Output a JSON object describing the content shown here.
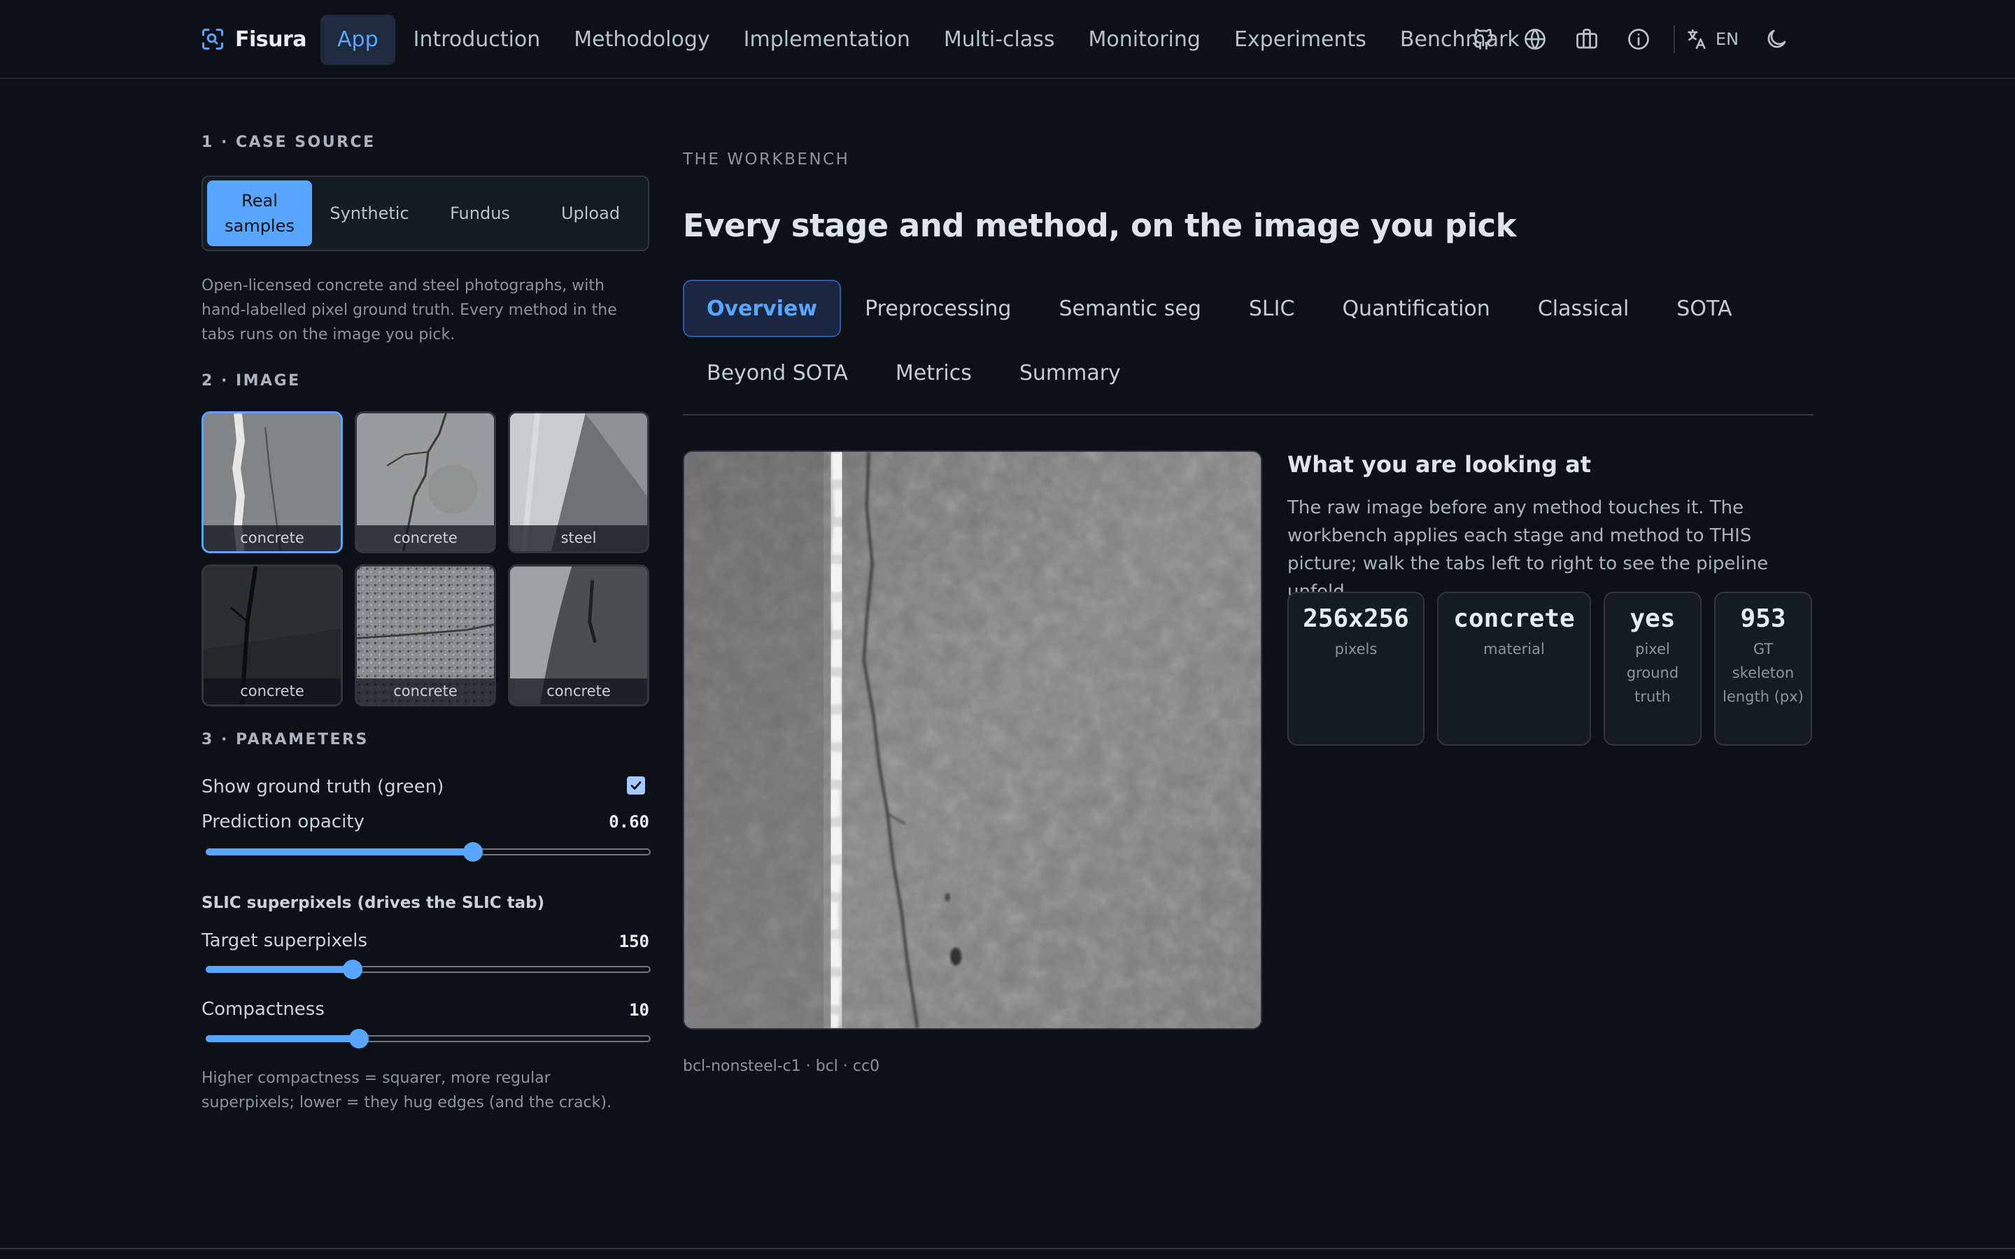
{
  "brand": {
    "name": "Fisura",
    "icon": "scan-icon"
  },
  "nav": {
    "items": [
      {
        "label": "App",
        "active": true
      },
      {
        "label": "Introduction"
      },
      {
        "label": "Methodology"
      },
      {
        "label": "Implementation"
      },
      {
        "label": "Multi-class"
      },
      {
        "label": "Monitoring"
      },
      {
        "label": "Experiments"
      },
      {
        "label": "Benchmark"
      }
    ],
    "icons": [
      "github-icon",
      "globe-icon",
      "briefcase-icon",
      "info-icon"
    ],
    "language": "EN",
    "theme_icon": "moon-icon"
  },
  "sidebar": {
    "case_source": {
      "title": "1 · CASE SOURCE",
      "options": [
        {
          "label": "Real samples",
          "active": true
        },
        {
          "label": "Synthetic"
        },
        {
          "label": "Fundus"
        },
        {
          "label": "Upload"
        }
      ],
      "description": "Open-licensed concrete and steel photographs, with hand-labelled pixel ground truth. Every method in the tabs runs on the image you pick."
    },
    "image": {
      "title": "2 · IMAGE",
      "thumbnails": [
        {
          "label": "concrete",
          "selected": true
        },
        {
          "label": "concrete"
        },
        {
          "label": "steel"
        },
        {
          "label": "concrete"
        },
        {
          "label": "concrete"
        },
        {
          "label": "concrete"
        }
      ]
    },
    "parameters": {
      "title": "3 · PARAMETERS",
      "show_gt_label": "Show ground truth (green)",
      "show_gt_checked": true,
      "opacity_label": "Prediction opacity",
      "opacity_value": "0.60",
      "opacity_fraction": 0.6,
      "slic_title": "SLIC superpixels (drives the SLIC tab)",
      "superpixels_label": "Target superpixels",
      "superpixels_value": "150",
      "superpixels_fraction": 0.33,
      "compactness_label": "Compactness",
      "compactness_value": "10",
      "compactness_fraction": 0.345,
      "hint": "Higher compactness = squarer, more regular superpixels; lower = they hug edges (and the crack)."
    }
  },
  "main": {
    "eyebrow": "THE WORKBENCH",
    "headline": "Every stage and method, on the image you pick",
    "tabs_row1": [
      {
        "label": "Overview",
        "active": true
      },
      {
        "label": "Preprocessing"
      },
      {
        "label": "Semantic seg"
      },
      {
        "label": "SLIC"
      },
      {
        "label": "Quantification"
      },
      {
        "label": "Classical"
      },
      {
        "label": "SOTA"
      }
    ],
    "tabs_row2": [
      {
        "label": "Beyond SOTA"
      },
      {
        "label": "Metrics"
      },
      {
        "label": "Summary"
      }
    ],
    "caption": "bcl-nonsteel-c1 · bcl · cc0",
    "look_title": "What you are looking at",
    "look_text": "The raw image before any method touches it. The workbench applies each stage and method to THIS picture; walk the tabs left to right to see the pipeline unfold.",
    "stats": [
      {
        "value": "256x256",
        "label": "pixels"
      },
      {
        "value": "concrete",
        "label": "material"
      },
      {
        "value": "yes",
        "label": "pixel ground truth"
      },
      {
        "value": "953",
        "label": "GT skeleton length (px)"
      }
    ]
  },
  "colors": {
    "background": "#0d1117",
    "accent": "#58a6ff",
    "panel": "#161b22",
    "border": "#30363d"
  }
}
